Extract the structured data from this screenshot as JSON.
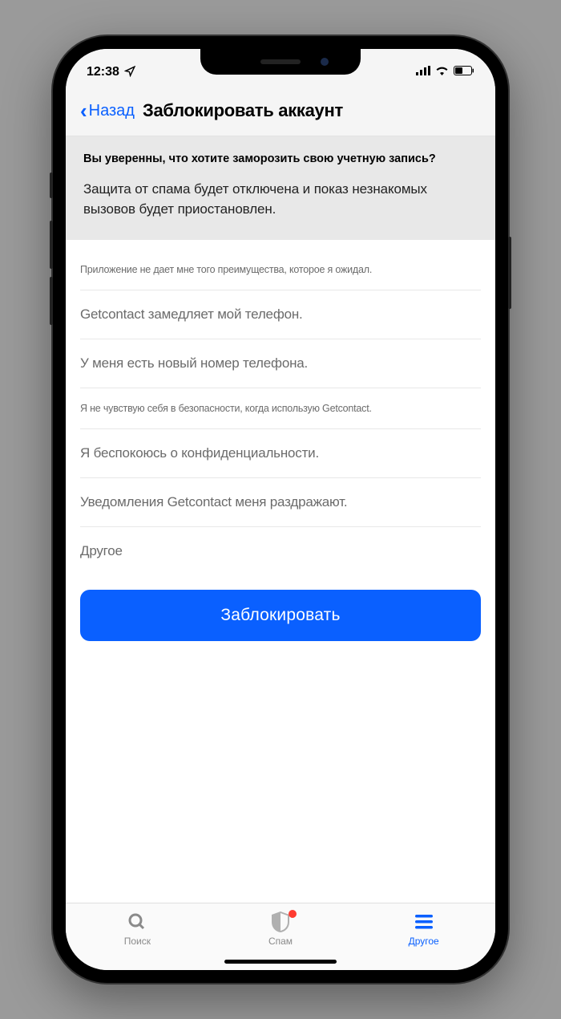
{
  "status": {
    "time": "12:38"
  },
  "nav": {
    "back": "Назад",
    "title": "Заблокировать аккаунт"
  },
  "banner": {
    "title": "Вы уверенны, что хотите заморозить свою учетную запись?",
    "sub": "Защита от спама будет отключена и показ незнакомых вызовов будет приостановлен."
  },
  "reasons": [
    "Приложение не дает мне того преимущества, которое я ожидал.",
    "Getcontact замедляет мой телефон.",
    "У меня есть новый номер телефона.",
    "Я не чувствую себя в безопасности, когда использую Getcontact.",
    "Я беспокоюсь о конфиденциальности.",
    "Уведомления Getcontact меня раздражают.",
    "Другое"
  ],
  "action": {
    "block": "Заблокировать"
  },
  "tabs": {
    "search": "Поиск",
    "spam": "Спам",
    "other": "Другое"
  }
}
